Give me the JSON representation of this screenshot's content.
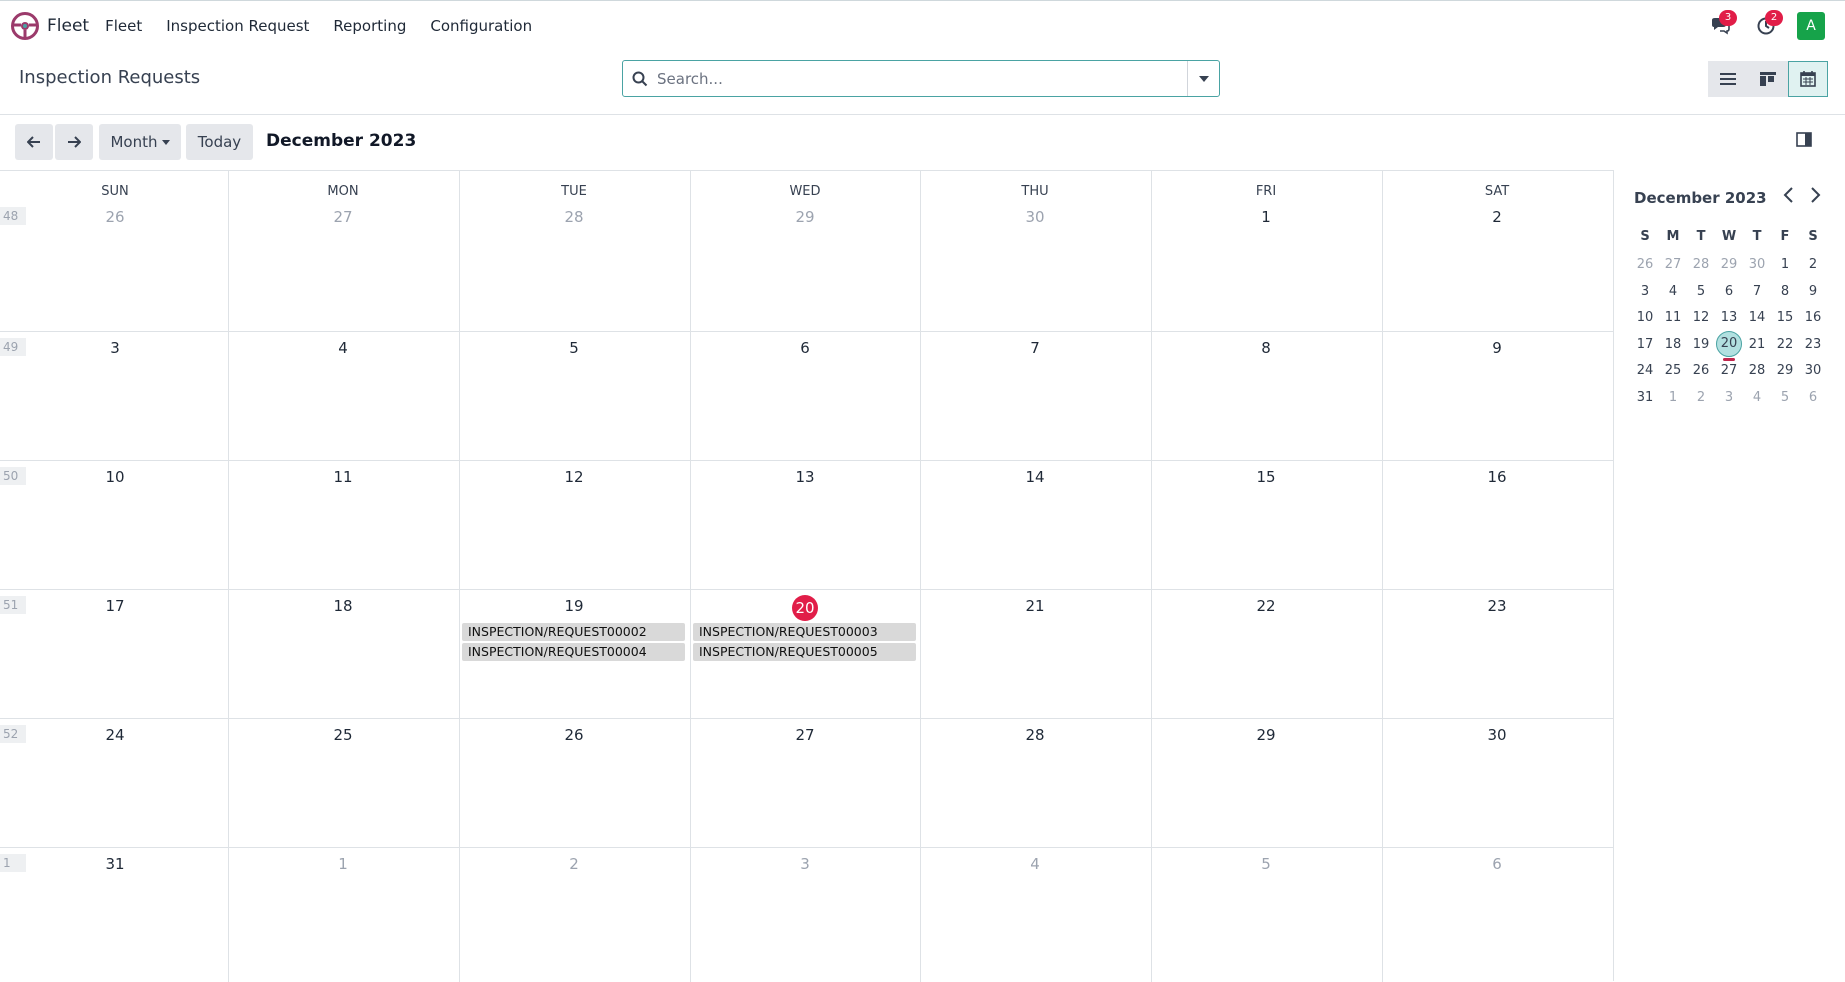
{
  "navbar": {
    "app_name": "Fleet",
    "menu": [
      "Fleet",
      "Inspection Request",
      "Reporting",
      "Configuration"
    ],
    "messages_badge": "3",
    "activities_badge": "2",
    "avatar_letter": "A",
    "icons": [
      "steering-wheel-logo",
      "chat-icon",
      "clock-icon"
    ]
  },
  "control_panel": {
    "title": "Inspection Requests",
    "search_placeholder": "Search...",
    "views": [
      "list",
      "kanban",
      "calendar"
    ],
    "active_view": "calendar"
  },
  "toolbar": {
    "scale": "Month",
    "today": "Today",
    "period": "December 2023"
  },
  "calendar": {
    "weekdays": [
      "SUN",
      "MON",
      "TUE",
      "WED",
      "THU",
      "FRI",
      "SAT"
    ],
    "weeks": [
      {
        "num": "48",
        "days": [
          "26",
          "27",
          "28",
          "29",
          "30",
          "1",
          "2"
        ],
        "other": [
          true,
          true,
          true,
          true,
          true,
          false,
          false
        ]
      },
      {
        "num": "49",
        "days": [
          "3",
          "4",
          "5",
          "6",
          "7",
          "8",
          "9"
        ],
        "other": [
          false,
          false,
          false,
          false,
          false,
          false,
          false
        ]
      },
      {
        "num": "50",
        "days": [
          "10",
          "11",
          "12",
          "13",
          "14",
          "15",
          "16"
        ],
        "other": [
          false,
          false,
          false,
          false,
          false,
          false,
          false
        ]
      },
      {
        "num": "51",
        "days": [
          "17",
          "18",
          "19",
          "20",
          "21",
          "22",
          "23"
        ],
        "other": [
          false,
          false,
          false,
          false,
          false,
          false,
          false
        ]
      },
      {
        "num": "52",
        "days": [
          "24",
          "25",
          "26",
          "27",
          "28",
          "29",
          "30"
        ],
        "other": [
          false,
          false,
          false,
          false,
          false,
          false,
          false
        ]
      },
      {
        "num": "1",
        "days": [
          "31",
          "1",
          "2",
          "3",
          "4",
          "5",
          "6"
        ],
        "other": [
          false,
          true,
          true,
          true,
          true,
          true,
          true
        ]
      }
    ],
    "today": {
      "week": 3,
      "day": 3
    },
    "events": [
      {
        "week": 3,
        "day": 2,
        "slot": 0,
        "label": "INSPECTION/REQUEST00002"
      },
      {
        "week": 3,
        "day": 2,
        "slot": 1,
        "label": "INSPECTION/REQUEST00004"
      },
      {
        "week": 3,
        "day": 3,
        "slot": 0,
        "label": "INSPECTION/REQUEST00003"
      },
      {
        "week": 3,
        "day": 3,
        "slot": 1,
        "label": "INSPECTION/REQUEST00005"
      }
    ]
  },
  "mini_calendar": {
    "title": "December 2023",
    "headers": [
      "S",
      "M",
      "T",
      "W",
      "T",
      "F",
      "S"
    ],
    "weeks": [
      [
        "26",
        "27",
        "28",
        "29",
        "30",
        "1",
        "2"
      ],
      [
        "3",
        "4",
        "5",
        "6",
        "7",
        "8",
        "9"
      ],
      [
        "10",
        "11",
        "12",
        "13",
        "14",
        "15",
        "16"
      ],
      [
        "17",
        "18",
        "19",
        "20",
        "21",
        "22",
        "23"
      ],
      [
        "24",
        "25",
        "26",
        "27",
        "28",
        "29",
        "30"
      ],
      [
        "31",
        "1",
        "2",
        "3",
        "4",
        "5",
        "6"
      ]
    ],
    "other": [
      [
        true,
        true,
        true,
        true,
        true,
        false,
        false
      ],
      [
        false,
        false,
        false,
        false,
        false,
        false,
        false
      ],
      [
        false,
        false,
        false,
        false,
        false,
        false,
        false
      ],
      [
        false,
        false,
        false,
        false,
        false,
        false,
        false
      ],
      [
        false,
        false,
        false,
        false,
        false,
        false,
        false
      ],
      [
        false,
        true,
        true,
        true,
        true,
        true,
        true
      ]
    ],
    "today": {
      "week": 3,
      "day": 3
    }
  },
  "colors": {
    "accent": "#4aa3a3",
    "today": "#e11d48",
    "avatar": "#16a34a",
    "event": "#d9d9d9"
  }
}
